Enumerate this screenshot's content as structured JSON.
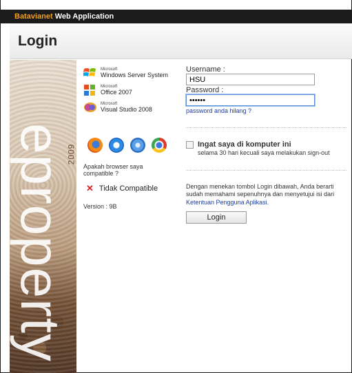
{
  "app": {
    "brand_part1": "Batavianet",
    "brand_part2": "Web Application"
  },
  "header": {
    "title": "Login"
  },
  "sidebar": {
    "brand_word": "eproperty",
    "year": "2009"
  },
  "products": [
    {
      "line1": "Microsoft",
      "line2": "Windows Server System"
    },
    {
      "line1": "Microsoft",
      "line2": "Office 2007"
    },
    {
      "line1": "Microsoft",
      "line2": "Visual Studio 2008"
    }
  ],
  "browsers": [
    "firefox-icon",
    "internet-explorer-icon",
    "safari-icon",
    "chrome-icon"
  ],
  "compat": {
    "question": "Apakah browser saya compatible ?",
    "status": "Tidak Compatible",
    "status_color": "#e02020"
  },
  "version": "Version : 9B",
  "form": {
    "username_label": "Username :",
    "username_value": "HSU",
    "password_label": "Password :",
    "password_value": "••••••",
    "forgot_link": "password anda hilang ?",
    "remember_label": "Ingat saya di komputer ini",
    "remember_sub": "selama 30 hari kecuali saya melakukan sign-out",
    "notice_text": "Dengan menekan tombol Login dibawah, Anda berarti sudah memahami sepenuhnya dan menyetujui isi dari",
    "terms_link": "Ketentuan Pengguna Aplikasi.",
    "login_button": "Login"
  },
  "colors": {
    "titlebar": "#1b1b1b",
    "brand_accent": "#f0a020",
    "link": "#1c3c9c"
  }
}
